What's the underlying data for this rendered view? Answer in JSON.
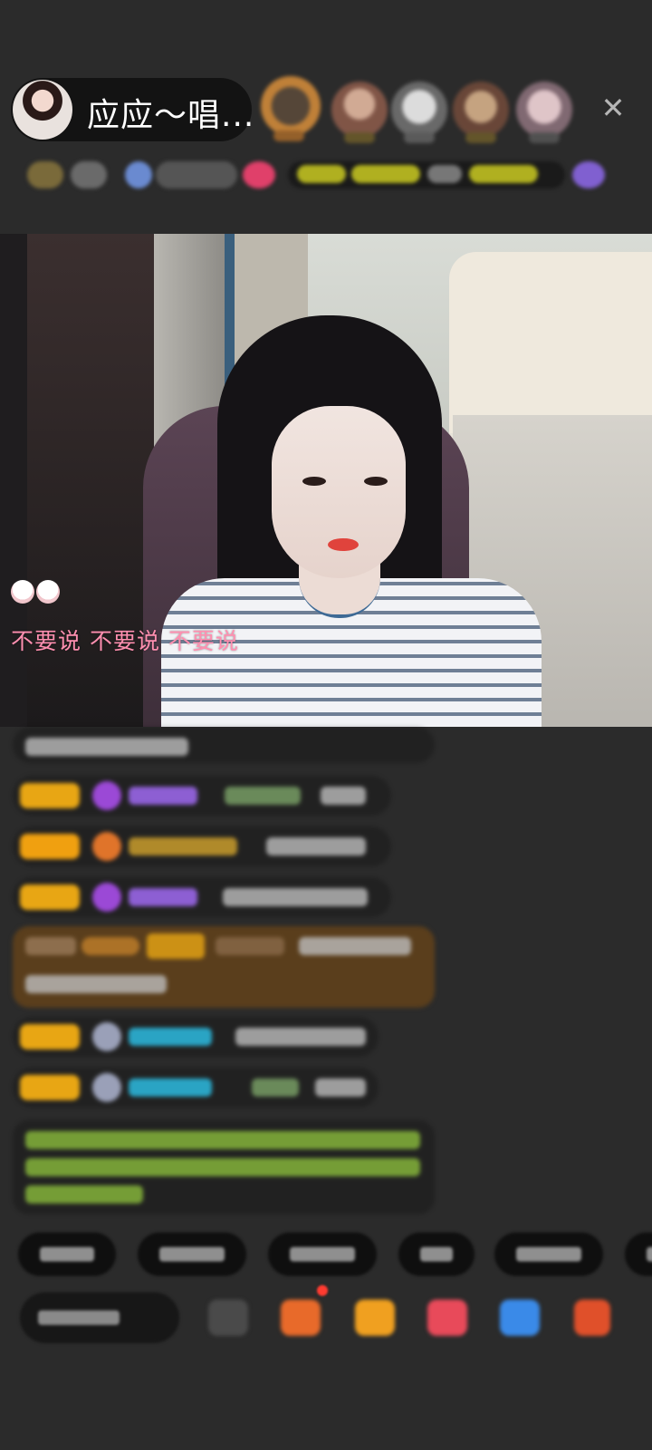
{
  "header": {
    "host_name": "应应～唱...",
    "close_icon": "close-icon",
    "viewer_avatar_colors": [
      "#c9763a",
      "#b08070",
      "#c8c8c8",
      "#a07050",
      "#b0909a"
    ]
  },
  "video": {
    "lyric_text": "不要说  不要说  不要说",
    "lyric_color": "#ff8fb0"
  },
  "colors": {
    "level_badge": "#e8a614",
    "highlight_row": "#5a3e1c",
    "system_text": "#8bbd3c",
    "user_name_purple": "#8d5fd3",
    "user_name_cyan": "#2aa4c4"
  }
}
